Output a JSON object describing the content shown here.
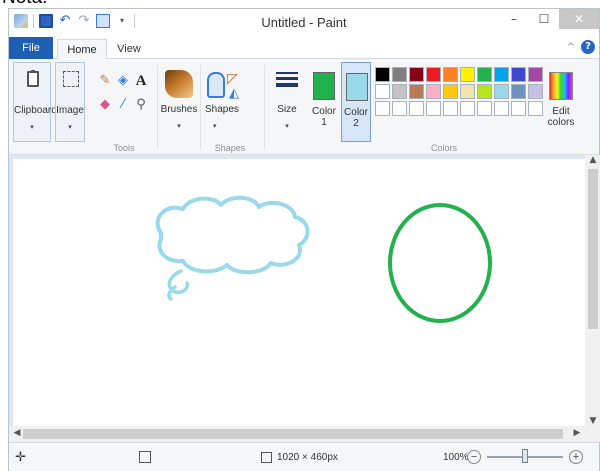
{
  "cropped_top_text": "Nota:",
  "window": {
    "title": "Untitled - Paint"
  },
  "quick_access": [
    "app-icon",
    "save-icon",
    "undo-icon",
    "redo-icon",
    "select-icon",
    "customize-icon"
  ],
  "window_buttons": {
    "minimize": "–",
    "maximize": "☐",
    "close": "✕"
  },
  "tabs": [
    {
      "label": "File",
      "active": false
    },
    {
      "label": "Home",
      "active": true
    },
    {
      "label": "View",
      "active": false
    }
  ],
  "ribbon": {
    "clipboard_label": "Clipboard",
    "image_label": "Image",
    "brushes_label": "Brushes",
    "shapes_label": "Shapes",
    "size_label": "Size",
    "color1_label": "Color 1",
    "color2_label": "Color 2",
    "edit_colors_label": "Edit colors",
    "drop_glyph": "▾",
    "groups": {
      "tools": "Tools",
      "shapes": "Shapes",
      "colors": "Colors"
    }
  },
  "colors": {
    "color1": "#22b14c",
    "color2": "#99d9ea",
    "palette": [
      [
        "#000000",
        "#7f7f7f",
        "#880015",
        "#ed1c24",
        "#ff7f27",
        "#fff200",
        "#22b14c",
        "#00a2e8",
        "#3f48cc",
        "#a349a4"
      ],
      [
        "#ffffff",
        "#c3c3c3",
        "#b97a57",
        "#ffaec9",
        "#ffc90e",
        "#efe4b0",
        "#b5e61d",
        "#99d9ea",
        "#7092be",
        "#c8bfe7"
      ],
      [
        "#ffffff",
        "#ffffff",
        "#ffffff",
        "#ffffff",
        "#ffffff",
        "#ffffff",
        "#ffffff",
        "#ffffff",
        "#ffffff",
        "#ffffff"
      ]
    ]
  },
  "canvas_shapes": [
    {
      "type": "cloud-callout",
      "stroke": "#99d9ea"
    },
    {
      "type": "ellipse",
      "stroke": "#22b14c"
    }
  ],
  "status": {
    "dimensions": "1020 × 460px",
    "zoom": "100%",
    "zoom_level": 0.5
  }
}
